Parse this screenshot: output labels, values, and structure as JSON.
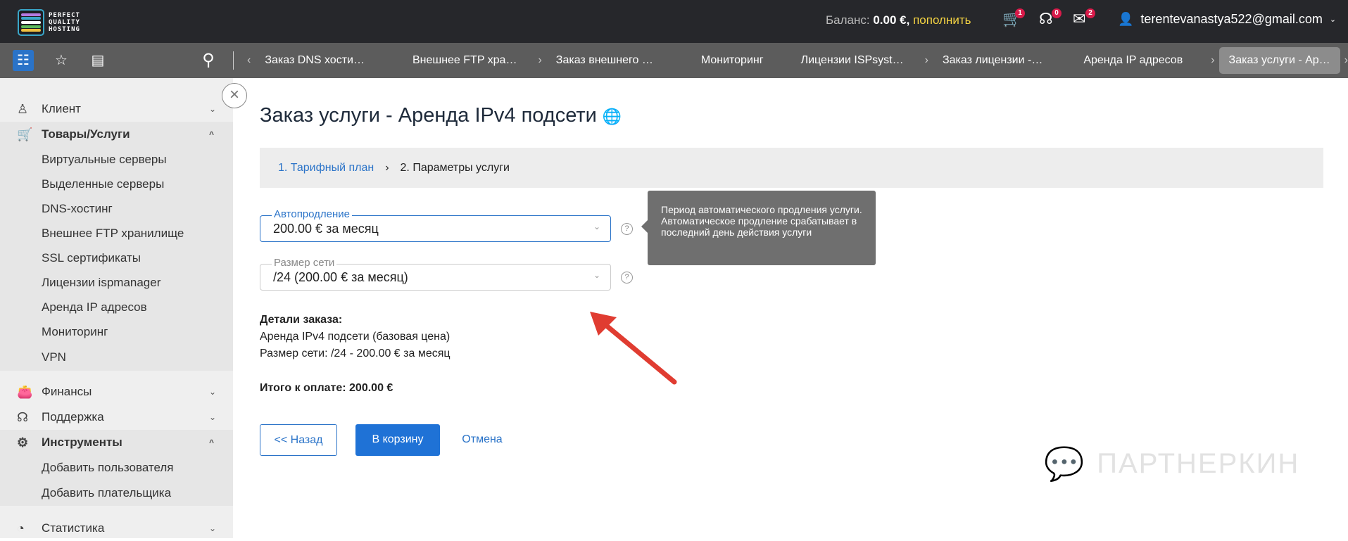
{
  "header": {
    "logo_text": [
      "PERFECT",
      "QUALITY",
      "HOSTING"
    ],
    "balance_label": "Баланс:",
    "balance_value": "0.00 €,",
    "topup_link": "пополнить",
    "cart_count": "1",
    "support_count": "0",
    "mail_count": "2",
    "user_email": "terentevanastya522@gmail.com"
  },
  "tabs": [
    "Заказ DNS хости…",
    "Внешнее FTP хра…",
    "Заказ внешнего …",
    "Мониторинг",
    "Лицензии ISPsyst…",
    "Заказ лицензии -…",
    "Аренда IP адресов",
    "Заказ услуги - Ар…"
  ],
  "sidebar": {
    "client": "Клиент",
    "goods": "Товары/Услуги",
    "goods_items": [
      "Виртуальные серверы",
      "Выделенные серверы",
      "DNS-хостинг",
      "Внешнее FTP хранилище",
      "SSL сертификаты",
      "Лицензии ispmanager",
      "Аренда IP адресов",
      "Мониторинг",
      "VPN"
    ],
    "finance": "Финансы",
    "support": "Поддержка",
    "tools": "Инструменты",
    "tools_items": [
      "Добавить пользователя",
      "Добавить плательщика"
    ],
    "stats": "Статистика"
  },
  "page": {
    "title": "Заказ услуги - Аренда IPv4 подсети",
    "step1": "1. Тарифный план",
    "step2": "2. Параметры услуги",
    "autorenew_label": "Автопродление",
    "autorenew_value": "200.00 € за месяц",
    "netsize_label": "Размер сети",
    "netsize_value": "/24 (200.00 € за месяц)",
    "tooltip": "Период автоматического продления услуги. Автоматическое продление срабатывает в последний день действия услуги",
    "details_title": "Детали заказа:",
    "details_line1": "Аренда IPv4 подсети (базовая цена)",
    "details_line2": "Размер сети: /24 - 200.00 € за месяц",
    "total": "Итого к оплате: 200.00 €",
    "back": "<< Назад",
    "to_cart": "В корзину",
    "cancel": "Отмена"
  },
  "watermark": "ПАРТНЕРКИН",
  "colors": {
    "accent": "#2a73c8",
    "topbar": "#26272b",
    "annotation_arrow": "#e03c31"
  }
}
